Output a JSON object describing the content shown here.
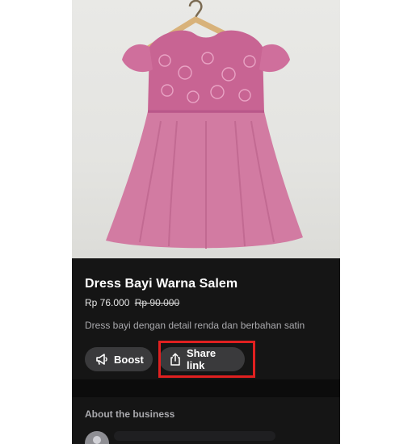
{
  "product": {
    "title": "Dress Bayi Warna Salem",
    "price": "Rp 76.000",
    "original_price": "Rp 90.000",
    "description": "Dress bayi dengan detail renda dan berbahan satin",
    "image_icon": "product-photo"
  },
  "actions": {
    "boost_label": "Boost",
    "boost_icon": "megaphone-icon",
    "share_label": "Share link",
    "share_icon": "share-icon",
    "highlight_color": "#e02020"
  },
  "about": {
    "title": "About the business",
    "avatar_icon": "avatar-icon"
  },
  "colors": {
    "background": "#151515",
    "button": "#3a3a3c",
    "dress": "#d27ba2"
  }
}
